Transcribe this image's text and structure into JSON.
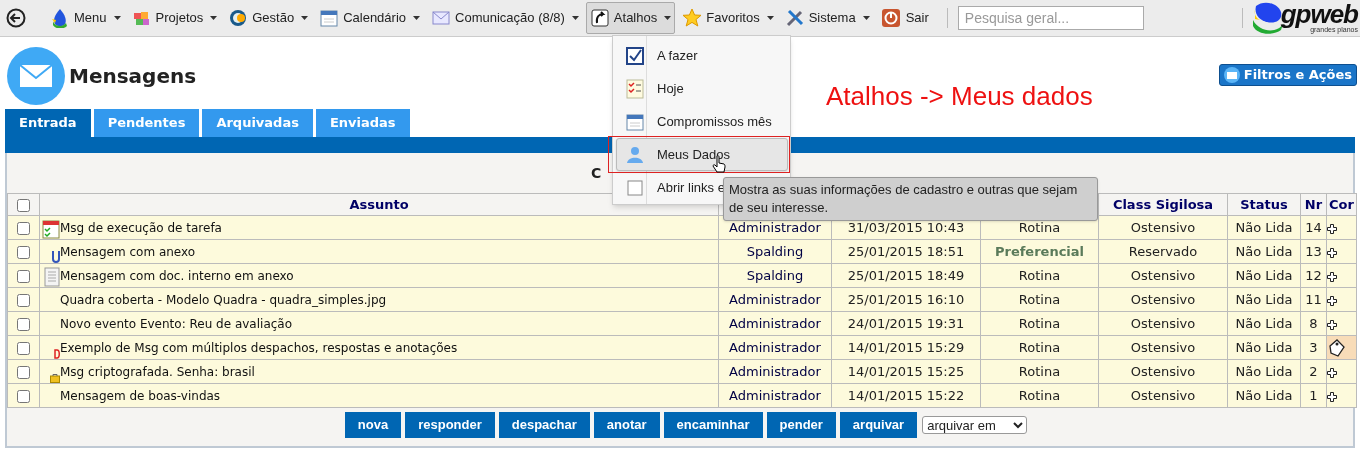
{
  "menubar": {
    "items": [
      {
        "label": "Menu",
        "kind": "drop",
        "selected": false
      },
      {
        "label": "Projetos",
        "kind": "puzzle",
        "selected": false
      },
      {
        "label": "Gestão",
        "kind": "globe",
        "selected": false
      },
      {
        "label": "Calendário",
        "kind": "calendar",
        "selected": false
      },
      {
        "label": "Comunicação (8/8)",
        "kind": "mail",
        "selected": false
      },
      {
        "label": "Atalhos",
        "kind": "shortcut",
        "selected": true
      },
      {
        "label": "Favoritos",
        "kind": "star",
        "selected": false
      },
      {
        "label": "Sistema",
        "kind": "tools",
        "selected": false
      }
    ],
    "exit": "Sair",
    "search": {
      "placeholder": "Pesquisa geral..."
    },
    "logo": {
      "text": "gpweb",
      "tagline": "grandes planos"
    }
  },
  "page": {
    "title": "Mensagens",
    "filters_button": "Filtros e Ações",
    "annotation": "Atalhos -> Meus dados"
  },
  "tabs": [
    {
      "label": "Entrada",
      "selected": true
    },
    {
      "label": "Pendentes",
      "selected": false
    },
    {
      "label": "Arquivadas",
      "selected": false
    },
    {
      "label": "Enviadas",
      "selected": false
    }
  ],
  "table": {
    "caption": "C",
    "select_all_checked": false,
    "columns": [
      {
        "label": "Assunto"
      },
      {},
      {},
      {},
      {
        "label": "Class Sigilosa"
      },
      {
        "label": "Status"
      },
      {
        "label": "Nr"
      },
      {
        "label": "Cor"
      }
    ],
    "rows": [
      {
        "kind": "task",
        "checked": false,
        "subject": "Msg de execução de tarefa",
        "sender": "Administrador",
        "date": "31/03/2015 10:43",
        "priority": "Rotina",
        "priority_emphasis": false,
        "classification": "Ostensivo",
        "status": "Não Lida",
        "nr": "14",
        "tagged": false
      },
      {
        "kind": "attachment",
        "checked": false,
        "subject": "Mensagem com anexo",
        "sender": "Spalding",
        "date": "25/01/2015 18:51",
        "priority": "Preferencial",
        "priority_emphasis": true,
        "classification": "Reservado",
        "status": "Não Lida",
        "nr": "13",
        "tagged": false
      },
      {
        "kind": "document",
        "checked": false,
        "subject": "Mensagem com doc. interno em anexo",
        "sender": "Spalding",
        "date": "25/01/2015 18:49",
        "priority": "Rotina",
        "priority_emphasis": false,
        "classification": "Ostensivo",
        "status": "Não Lida",
        "nr": "12",
        "tagged": false
      },
      {
        "kind": "plain",
        "checked": false,
        "subject": "Quadra coberta - Modelo Quadra - quadra_simples.jpg",
        "sender": "Administrador",
        "date": "25/01/2015 16:10",
        "priority": "Rotina",
        "priority_emphasis": false,
        "classification": "Ostensivo",
        "status": "Não Lida",
        "nr": "11",
        "tagged": false
      },
      {
        "kind": "plain",
        "checked": false,
        "subject": "Novo evento Evento: Reu de avaliação",
        "sender": "Administrador",
        "date": "24/01/2015 19:31",
        "priority": "Rotina",
        "priority_emphasis": false,
        "classification": "Ostensivo",
        "status": "Não Lida",
        "nr": "8",
        "tagged": false
      },
      {
        "kind": "dispatch",
        "checked": false,
        "subject": "Exemplo de Msg com múltiplos despachos, respostas e anotações",
        "sender": "Administrador",
        "date": "14/01/2015 15:29",
        "priority": "Rotina",
        "priority_emphasis": false,
        "classification": "Ostensivo",
        "status": "Não Lida",
        "nr": "3",
        "tagged": true
      },
      {
        "kind": "locked",
        "checked": false,
        "subject": "Msg criptografada. Senha: brasil",
        "sender": "Administrador",
        "date": "14/01/2015 15:25",
        "priority": "Rotina",
        "priority_emphasis": false,
        "classification": "Ostensivo",
        "status": "Não Lida",
        "nr": "2",
        "tagged": false
      },
      {
        "kind": "plain",
        "checked": false,
        "subject": "Mensagem de boas-vindas",
        "sender": "Administrador",
        "date": "14/01/2015 15:22",
        "priority": "Rotina",
        "priority_emphasis": false,
        "classification": "Ostensivo",
        "status": "Não Lida",
        "nr": "1",
        "tagged": false
      }
    ]
  },
  "actions": [
    "nova",
    "responder",
    "despachar",
    "anotar",
    "encaminhar",
    "pender",
    "arquivar"
  ],
  "archive_select": "arquivar em",
  "dropdown": {
    "items": [
      {
        "label": "A fazer",
        "kind": "todo",
        "selected": false
      },
      {
        "label": "Hoje",
        "kind": "checklist",
        "selected": false
      },
      {
        "label": "Compromissos mês",
        "kind": "calendar",
        "selected": false
      },
      {
        "label": "Meus Dados",
        "kind": "person",
        "selected": true
      },
      {
        "label": "Abrir links e",
        "kind": "checkbox",
        "selected": false
      }
    ]
  },
  "tooltip": "Mostra as suas informações de cadastro e outras que sejam de seu interesse."
}
